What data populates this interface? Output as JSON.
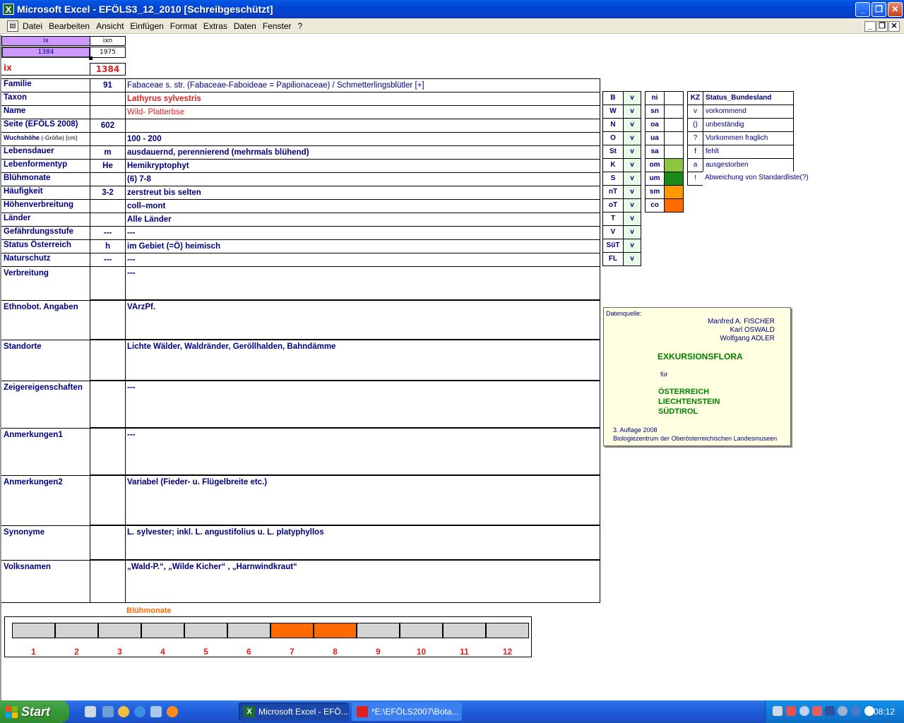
{
  "window": {
    "title": "Microsoft Excel - EFÖLS3_12_2010  [Schreibgeschützt]",
    "app_icon": "X"
  },
  "menu": [
    "Datei",
    "Bearbeiten",
    "Ansicht",
    "Einfügen",
    "Format",
    "Extras",
    "Daten",
    "Fenster",
    "?"
  ],
  "top_cells": {
    "ix_header": "ix",
    "ixn_header": "ixn",
    "ix_value": "1384",
    "ixn_value": "1975",
    "ix_label": "ix",
    "ix_big": "1384"
  },
  "rows": [
    {
      "label": "Familie",
      "num": "91",
      "value": "Fabaceae s. str. (Fabaceae-Faboideae = Papilionaceae)  /  Schmetterlingsblütler [+]"
    },
    {
      "label": "Taxon",
      "num": "",
      "value": "Lathyrus sylvestris"
    },
    {
      "label": "Name",
      "num": "",
      "value": "Wild- Platterbse"
    },
    {
      "label": "Seite (EFÖLS 2008)",
      "num": "602",
      "value": ""
    },
    {
      "label": "Wuchshöhe",
      "label_sub": " (-Größe) [cm]",
      "num": "",
      "value": " 100 - 200"
    },
    {
      "label": "Lebensdauer",
      "num": "m",
      "value": "ausdauernd, perennierend (mehrmals blühend)"
    },
    {
      "label": "Lebenformentyp",
      "num": "He",
      "value": "Hemikryptophyt"
    },
    {
      "label": "Blühmonate",
      "num": "",
      "value": "(6) 7-8"
    },
    {
      "label": "Häufigkeit",
      "num": "3-2",
      "value": "zerstreut bis selten"
    },
    {
      "label": "Höhenverbreitung",
      "num": "",
      "value": "coll–mont"
    },
    {
      "label": "Länder",
      "num": "",
      "value": "Alle Länder"
    },
    {
      "label": "Gefährdungsstufe",
      "num": "---",
      "value": "  ---"
    },
    {
      "label": "Status Österreich",
      "num": "h",
      "value": "im Gebiet (=Ö) heimisch"
    },
    {
      "label": "Naturschutz",
      "num": "---",
      "value": " ---"
    }
  ],
  "big_rows": [
    {
      "label": "Verbreitung",
      "value": " ---"
    },
    {
      "label": "Ethnobot. Angaben",
      "value": "VArzPf."
    },
    {
      "label": "Standorte",
      "value": "Lichte Wälder, Waldränder, Geröllhalden, Bahndämme"
    },
    {
      "label": "Zeigereigenschaften",
      "value": "---"
    },
    {
      "label": "Anmerkungen1",
      "value": "---"
    },
    {
      "label": "Anmerkungen2",
      "value": "Variabel (Fieder- u. Flügelbreite etc.)"
    },
    {
      "label": "Synonyme",
      "value": "L. sylvester; inkl. L. angustifolius u. L. platyphyllos"
    },
    {
      "label": "Volksnamen",
      "value": "„Wald-P.“, „Wilde Kicher“ , „Harnwindkraut“"
    }
  ],
  "bundeslaender": [
    {
      "k": "B",
      "v": "v"
    },
    {
      "k": "W",
      "v": "v"
    },
    {
      "k": "N",
      "v": "v"
    },
    {
      "k": "O",
      "v": "v"
    },
    {
      "k": "St",
      "v": "v"
    },
    {
      "k": "K",
      "v": "v"
    },
    {
      "k": "S",
      "v": "v"
    },
    {
      "k": "nT",
      "v": "v"
    },
    {
      "k": "oT",
      "v": "v"
    },
    {
      "k": "T",
      "v": "v"
    },
    {
      "k": "V",
      "v": "v"
    },
    {
      "k": "SüT",
      "v": "v"
    },
    {
      "k": "FL",
      "v": "v"
    }
  ],
  "hoehenstufen": [
    {
      "k": "ni",
      "color": "#ffffff"
    },
    {
      "k": "sn",
      "color": "#ffffff"
    },
    {
      "k": "oa",
      "color": "#ffffff"
    },
    {
      "k": "ua",
      "color": "#ffffff"
    },
    {
      "k": "sa",
      "color": "#ffffff"
    },
    {
      "k": "om",
      "color": "#8cc63f"
    },
    {
      "k": "um",
      "color": "#1a8a1a"
    },
    {
      "k": "sm",
      "color": "#ff9900"
    },
    {
      "k": "co",
      "color": "#ff6a00"
    }
  ],
  "status_legend": {
    "header_kz": "KZ",
    "header_title": "Status_Bundesland",
    "items": [
      {
        "kz": "v",
        "text": "vorkommend"
      },
      {
        "kz": "()",
        "text": "unbeständig"
      },
      {
        "kz": "?",
        "text": "Vorkommen fraglich"
      },
      {
        "kz": "f",
        "text": "fehlt"
      },
      {
        "kz": "a",
        "text": "ausgestorben"
      },
      {
        "kz": "!",
        "text": "Abweichung von Standardliste(?)"
      }
    ]
  },
  "datenquelle": {
    "label": "Datenquelle:",
    "authors": [
      "Manfred A. FISCHER",
      "Karl OSWALD",
      "Wolfgang ADLER"
    ],
    "title": "EXKURSIONSFLORA",
    "fuer": "für",
    "countries": [
      "ÖSTERREICH",
      "LIECHTENSTEIN",
      "SÜDTIROL"
    ],
    "edition": "3. Auflage 2008",
    "publisher": "Biologiezentrum der Oberösterreichischen Landesmuseen"
  },
  "bluehmonate_chart": {
    "title": "Blühmonate",
    "months": [
      "1",
      "2",
      "3",
      "4",
      "5",
      "6",
      "7",
      "8",
      "9",
      "10",
      "11",
      "12"
    ],
    "active": [
      false,
      false,
      false,
      false,
      false,
      false,
      true,
      true,
      false,
      false,
      false,
      false
    ]
  },
  "taskbar": {
    "start": "Start",
    "tasks": [
      "Microsoft Excel - EFÖ...",
      "*E:\\EFÖLS2007\\Bota..."
    ],
    "clock": "08:12"
  }
}
